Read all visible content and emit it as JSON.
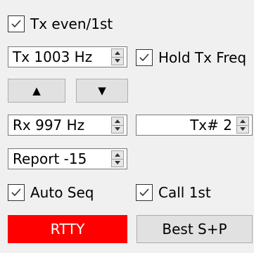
{
  "tx_even": {
    "label": "Tx even/1st",
    "checked": true
  },
  "tx_freq": {
    "text": "Tx  1003 Hz"
  },
  "hold_tx_freq": {
    "label": "Hold Tx Freq",
    "checked": true
  },
  "freq_up_icon": "▲",
  "freq_down_icon": "▼",
  "rx_freq": {
    "text": "Rx  997 Hz"
  },
  "tx_number": {
    "text": "Tx# 2"
  },
  "report": {
    "text": "Report -15"
  },
  "auto_seq": {
    "label": "Auto Seq",
    "checked": true
  },
  "call_1st": {
    "label": "Call 1st",
    "checked": true
  },
  "rtty_button": {
    "label": "RTTY",
    "color": "#ff0000"
  },
  "best_sp_button": {
    "label": "Best S+P"
  }
}
